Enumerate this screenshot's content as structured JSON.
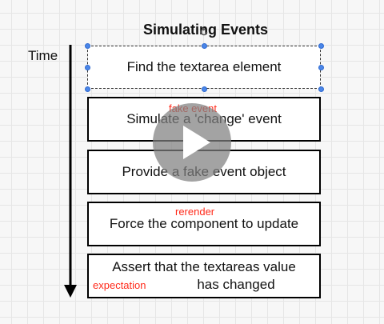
{
  "diagram": {
    "title": "Simulating Events",
    "time_label": "Time",
    "steps": [
      {
        "text": "Find the textarea element"
      },
      {
        "text": "Simulate a 'change' event"
      },
      {
        "text": "Provide a fake event object"
      },
      {
        "text": "Force the component to update"
      },
      {
        "text_line1": "Assert that the textareas value",
        "text_line2": "has changed"
      }
    ],
    "annotations": {
      "fake_event": "fake event",
      "rerender": "rerender",
      "expectation": "expectation"
    }
  },
  "colors": {
    "annotation": "#ff2a1a",
    "selection_handle": "#4a86e8",
    "grid": "#e6e6e6"
  },
  "icons": {
    "rotate": "rotate-icon",
    "play": "play-icon"
  }
}
